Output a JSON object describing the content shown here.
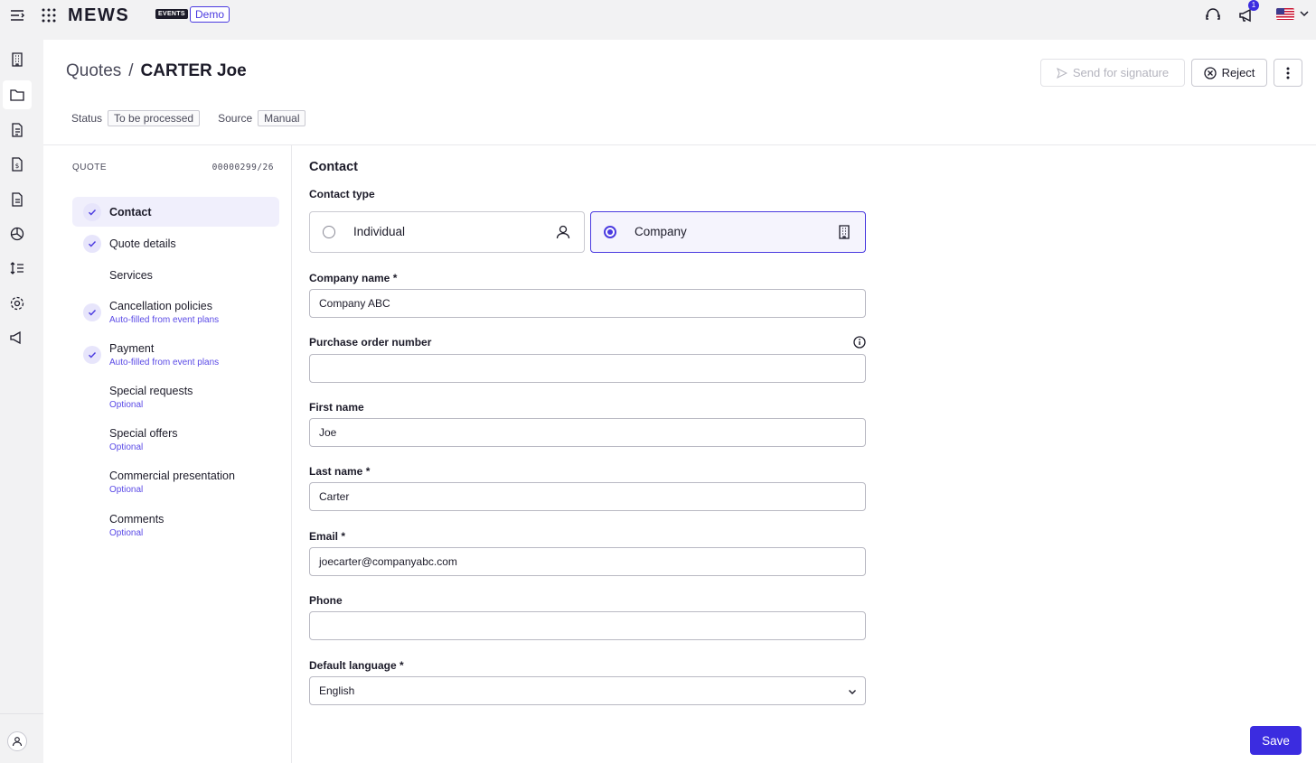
{
  "app": {
    "logo": "MEWS",
    "logo_badge": "EVENTS",
    "env_badge": "Demo",
    "notification_count": "1"
  },
  "breadcrumb": {
    "parent": "Quotes",
    "separator": "/",
    "current": "CARTER Joe"
  },
  "actions": {
    "send": "Send for signature",
    "reject": "Reject"
  },
  "meta": {
    "status_label": "Status",
    "status_value": "To be processed",
    "source_label": "Source",
    "source_value": "Manual"
  },
  "steps": {
    "heading": "QUOTE",
    "number": "00000299/26",
    "items": [
      {
        "label": "Contact",
        "sub": "",
        "done": true
      },
      {
        "label": "Quote details",
        "sub": "",
        "done": true
      },
      {
        "label": "Services",
        "sub": "",
        "done": false
      },
      {
        "label": "Cancellation policies",
        "sub": "Auto-filled from event plans",
        "done": true
      },
      {
        "label": "Payment",
        "sub": "Auto-filled from event plans",
        "done": true
      },
      {
        "label": "Special requests",
        "sub": "Optional",
        "done": false
      },
      {
        "label": "Special offers",
        "sub": "Optional",
        "done": false
      },
      {
        "label": "Commercial presentation",
        "sub": "Optional",
        "done": false
      },
      {
        "label": "Comments",
        "sub": "Optional",
        "done": false
      }
    ]
  },
  "form": {
    "title": "Contact",
    "contact_type_label": "Contact type",
    "contact_types": {
      "individual": "Individual",
      "company": "Company"
    },
    "company_name": {
      "label": "Company name *",
      "value": "Company ABC"
    },
    "po_number": {
      "label": "Purchase order number",
      "value": ""
    },
    "first_name": {
      "label": "First name",
      "value": "Joe"
    },
    "last_name": {
      "label": "Last name *",
      "value": "Carter"
    },
    "email": {
      "label": "Email *",
      "value": "joecarter@companyabc.com"
    },
    "phone": {
      "label": "Phone",
      "value": ""
    },
    "language": {
      "label": "Default language *",
      "value": "English"
    },
    "save": "Save"
  },
  "colors": {
    "accent": "#3b2ce0",
    "selected_border": "#4a3ae0",
    "sub_text": "#5a4ae6"
  }
}
